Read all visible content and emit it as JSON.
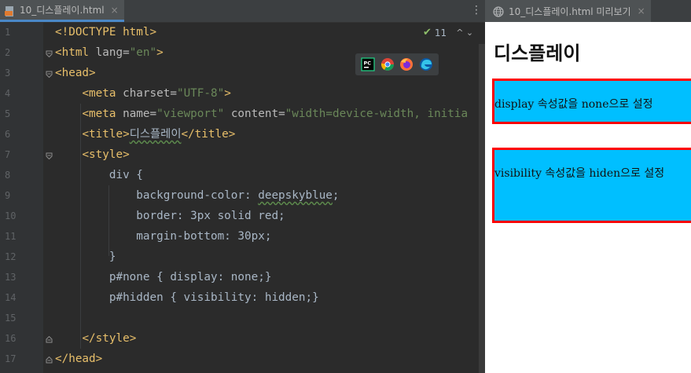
{
  "editor": {
    "tab_label": "10_디스플레이.html",
    "tab_close": "×",
    "inspection_count": "11",
    "inspection_nav": "^ ⌄",
    "menu_glyph": "⋮",
    "line_numbers": [
      "1",
      "2",
      "3",
      "4",
      "5",
      "6",
      "7",
      "8",
      "9",
      "10",
      "11",
      "12",
      "13",
      "14",
      "15",
      "16",
      "17"
    ],
    "code": {
      "l1": "<!DOCTYPE html>",
      "l2": {
        "open": "<html ",
        "attr": "lang",
        "eq": "=",
        "val": "\"en\"",
        "close": ">"
      },
      "l3": "<head>",
      "l4": {
        "indent": "    ",
        "open": "<meta ",
        "attr": "charset",
        "eq": "=",
        "val": "\"UTF-8\"",
        "close": ">"
      },
      "l5": {
        "indent": "    ",
        "open": "<meta ",
        "attr1": "name",
        "eq1": "=",
        "val1": "\"viewport\"",
        "sp": " ",
        "attr2": "content",
        "eq2": "=",
        "val2": "\"width=device-width, initia"
      },
      "l6": {
        "indent": "    ",
        "open": "<title>",
        "text": "디스플레이",
        "close": "</title>"
      },
      "l7": {
        "indent": "    ",
        "tag": "<style>"
      },
      "l8": "        div {",
      "l9": {
        "indent": "            ",
        "prop": "background-color: ",
        "val": "deepskyblue",
        "end": ";"
      },
      "l10": "            border: 3px solid red;",
      "l11": "            margin-bottom: 30px;",
      "l12": "        }",
      "l13": "        p#none { display: none;}",
      "l14": "        p#hidden { visibility: hidden;}",
      "l15": "",
      "l16": {
        "indent": "    ",
        "tag": "</style>"
      },
      "l17": "</head>"
    }
  },
  "preview": {
    "tab_label": "10_디스플레이.html 미리보기",
    "tab_close": "×",
    "heading": "디스플레이",
    "box1_text": "display 속성값을 none으로 설정",
    "box2_text": "visibility 속성값을 hiden으로 설정"
  },
  "icons": {
    "file": "html-file-icon",
    "globe": "globe-icon",
    "browsers": [
      "pycharm-icon",
      "chrome-icon",
      "firefox-icon",
      "edge-icon"
    ]
  },
  "colors": {
    "tag": "#e8bf6a",
    "attr": "#bababa",
    "string": "#6a8759",
    "text": "#a9b7c6",
    "preview_box_bg": "#00bfff",
    "preview_box_border": "#ff0000"
  }
}
